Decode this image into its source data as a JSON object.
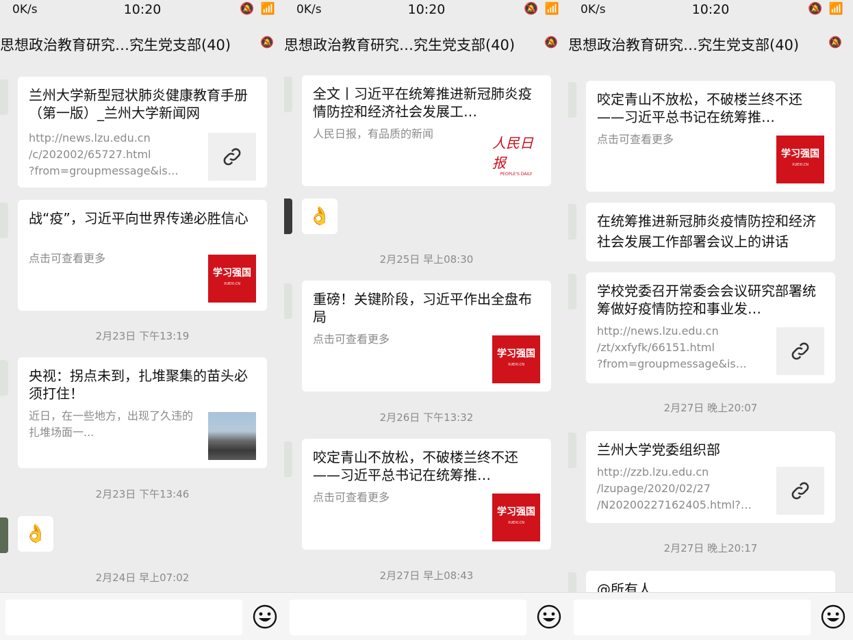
{
  "status": {
    "speed": "0K/s",
    "time": "10:20",
    "icons": "🔕 📶"
  },
  "chat_title": "思想政治教育研究…究生党支部(40)",
  "panels": [
    {
      "cards": [
        {
          "title": "兰州大学新型冠状肺炎健康教育手册（第一版）_兰州大学新闻网",
          "desc": "http://news.lzu.edu.cn\n/c/202002/65727.html\n?from=groupmessage&is…"
        },
        {
          "title": "战“疫”，习近平向世界传递必胜信心",
          "desc": "点击可查看更多"
        },
        {
          "title": "央视：拐点未到，扎堆聚集的苗头必须打住！",
          "desc": "近日，在一些地方，出现了久违的扎堆场面一..."
        }
      ],
      "timestamps": [
        "2月23日 下午13:19",
        "2月23日 下午13:46",
        "2月24日 早上07:02"
      ],
      "emoji": "👌"
    },
    {
      "cards": [
        {
          "title": "全文丨习近平在统筹推进新冠肺炎疫情防控和经济社会发展工…",
          "desc": "人民日报，有品质的新闻"
        },
        {
          "title": "重磅！关键阶段，习近平作出全盘布局",
          "desc": "点击可查看更多"
        },
        {
          "title": "咬定青山不放松，不破楼兰终不还——习近平总书记在统筹推…",
          "desc": "点击可查看更多"
        }
      ],
      "timestamps": [
        "2月25日 早上08:30",
        "2月26日 下午13:32",
        "2月27日 早上08:43"
      ],
      "emoji": "👌"
    },
    {
      "cards": [
        {
          "title": "咬定青山不放松，不破楼兰终不还——习近平总书记在统筹推…",
          "desc": "点击可查看更多"
        },
        {
          "title": "在统筹推进新冠肺炎疫情防控和经济社会发展工作部署会议上的讲话",
          "desc": ""
        },
        {
          "title": "学校党委召开常委会会议研究部署统筹做好疫情防控和事业发…",
          "desc": "http://news.lzu.edu.cn\n/zt/xxfyfk/66151.html\n?from=groupmessage&is…"
        },
        {
          "title": "兰州大学党委组织部",
          "desc": "http://zzb.lzu.edu.cn\n/lzupage/2020/02/27\n/N20200227162405.html?…"
        },
        {
          "title": "@所有人",
          "desc": ""
        }
      ],
      "timestamps": [
        "2月27日 晚上20:07",
        "2月27日 晚上20:17"
      ]
    }
  ],
  "thumbs": {
    "xuexi": {
      "main": "学习强国",
      "sub": "XUEXI.CN"
    },
    "rmrb": {
      "main": "人民日报",
      "sub": "PEOPLE'S DAILY"
    }
  }
}
